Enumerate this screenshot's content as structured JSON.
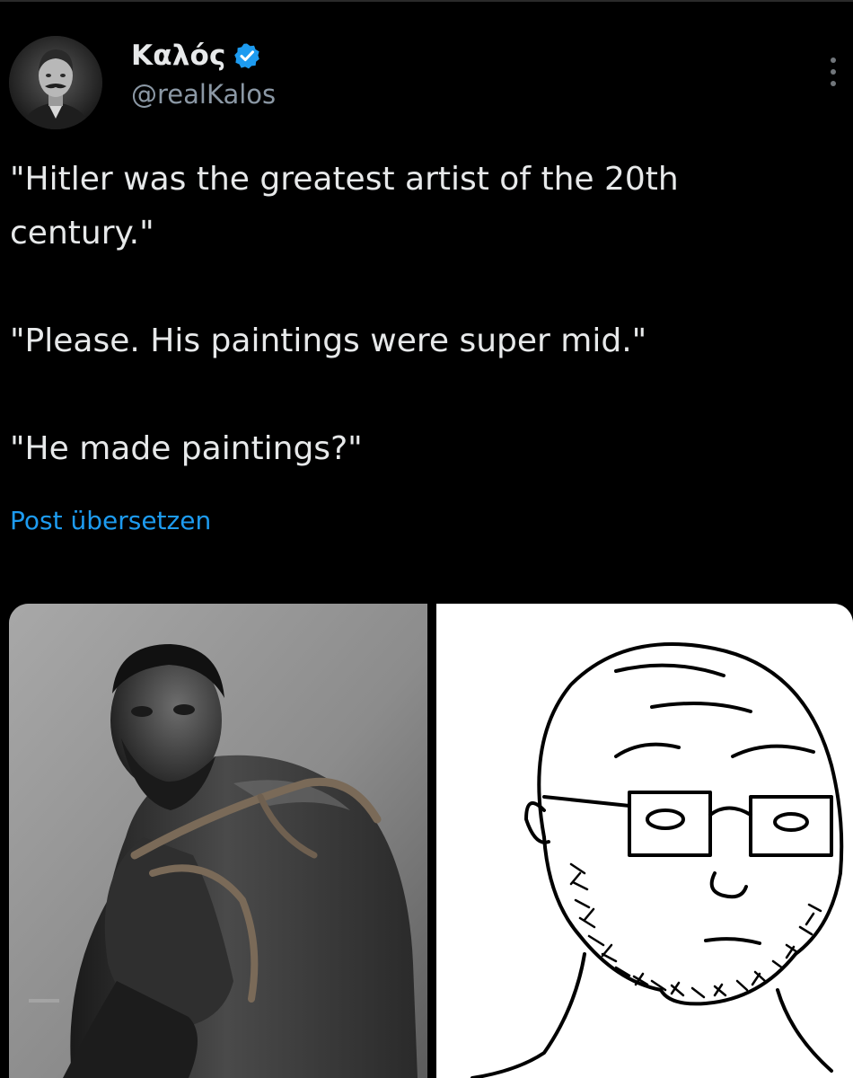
{
  "tweet": {
    "author": {
      "display_name": "Καλός",
      "handle": "@realKalos",
      "verified": true
    },
    "text_lines": [
      "\"Hitler was the greatest artist of the 20th",
      "century.\"",
      "\"Please. His paintings were super mid.\"",
      "\"He made paintings?\""
    ],
    "translate_label": "Post übersetzen",
    "media": {
      "left_image": "gigachad-photo",
      "right_image": "wojak-glasses-drawing"
    }
  },
  "colors": {
    "background": "#000000",
    "text": "#e7e9ea",
    "secondary_text": "#8b98a5",
    "link": "#1d9bf0",
    "verified_badge": "#1d9bf0"
  }
}
